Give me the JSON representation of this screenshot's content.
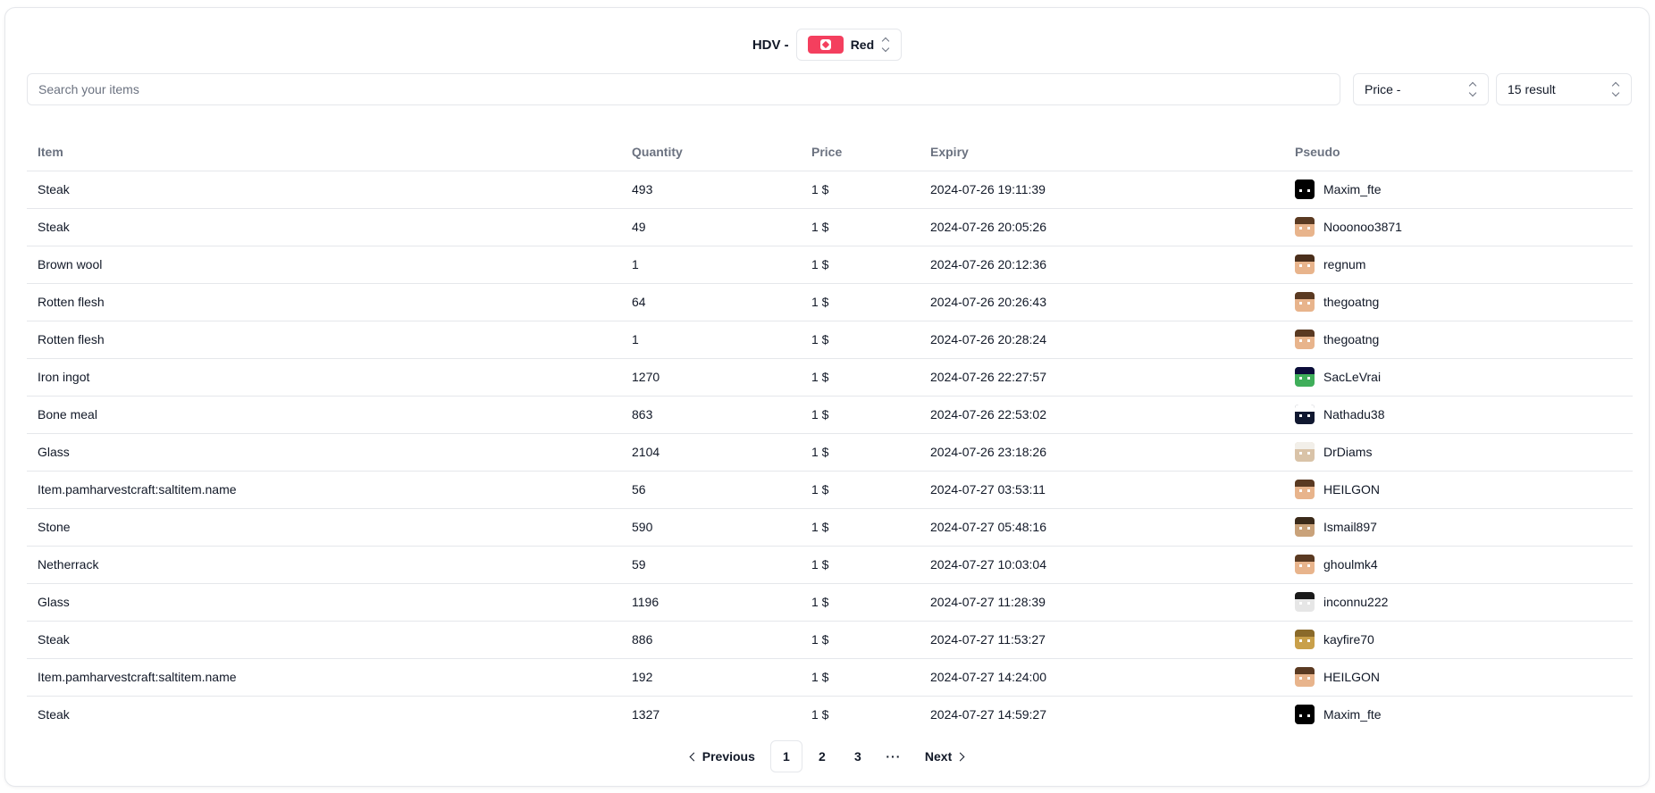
{
  "header": {
    "label": "HDV -",
    "server": {
      "name": "Red",
      "color": "#f43f5e",
      "icon": "cube-icon"
    }
  },
  "search": {
    "placeholder": "Search your items",
    "value": ""
  },
  "filters": {
    "sort": "Price -",
    "results": "15 result"
  },
  "table": {
    "columns": [
      "Item",
      "Quantity",
      "Price",
      "Expiry",
      "Pseudo"
    ],
    "rows": [
      {
        "item": "Steak",
        "quantity": "493",
        "price": "1 $",
        "expiry": "2024-07-26 19:11:39",
        "pseudo": "Maxim_fte",
        "avatar": {
          "skin": "#000000",
          "hair": "#000000"
        }
      },
      {
        "item": "Steak",
        "quantity": "49",
        "price": "1 $",
        "expiry": "2024-07-26 20:05:26",
        "pseudo": "Nooonoo3871",
        "avatar": {
          "skin": "#e8b48c",
          "hair": "#5a3a22"
        }
      },
      {
        "item": "Brown wool",
        "quantity": "1",
        "price": "1 $",
        "expiry": "2024-07-26 20:12:36",
        "pseudo": "regnum",
        "avatar": {
          "skin": "#e8b48c",
          "hair": "#4a2f1c"
        }
      },
      {
        "item": "Rotten flesh",
        "quantity": "64",
        "price": "1 $",
        "expiry": "2024-07-26 20:26:43",
        "pseudo": "thegoatng",
        "avatar": {
          "skin": "#e8b48c",
          "hair": "#5a3a22"
        }
      },
      {
        "item": "Rotten flesh",
        "quantity": "1",
        "price": "1 $",
        "expiry": "2024-07-26 20:28:24",
        "pseudo": "thegoatng",
        "avatar": {
          "skin": "#e8b48c",
          "hair": "#5a3a22"
        }
      },
      {
        "item": "Iron ingot",
        "quantity": "1270",
        "price": "1 $",
        "expiry": "2024-07-26 22:27:57",
        "pseudo": "SacLeVrai",
        "avatar": {
          "skin": "#3fae5a",
          "hair": "#0c0c3a"
        }
      },
      {
        "item": "Bone meal",
        "quantity": "863",
        "price": "1 $",
        "expiry": "2024-07-26 22:53:02",
        "pseudo": "Nathadu38",
        "avatar": {
          "skin": "#101830",
          "hair": "#ffffff"
        }
      },
      {
        "item": "Glass",
        "quantity": "2104",
        "price": "1 $",
        "expiry": "2024-07-26 23:18:26",
        "pseudo": "DrDiams",
        "avatar": {
          "skin": "#d9c3a8",
          "hair": "#f2efe9"
        }
      },
      {
        "item": "Item.pamharvestcraft:saltitem.name",
        "quantity": "56",
        "price": "1 $",
        "expiry": "2024-07-27 03:53:11",
        "pseudo": "HEILGON",
        "avatar": {
          "skin": "#e8b48c",
          "hair": "#5a3a22"
        }
      },
      {
        "item": "Stone",
        "quantity": "590",
        "price": "1 $",
        "expiry": "2024-07-27 05:48:16",
        "pseudo": "Ismail897",
        "avatar": {
          "skin": "#c9a27a",
          "hair": "#3a2a1a"
        }
      },
      {
        "item": "Netherrack",
        "quantity": "59",
        "price": "1 $",
        "expiry": "2024-07-27 10:03:04",
        "pseudo": "ghoulmk4",
        "avatar": {
          "skin": "#e8b48c",
          "hair": "#5a3a22"
        }
      },
      {
        "item": "Glass",
        "quantity": "1196",
        "price": "1 $",
        "expiry": "2024-07-27 11:28:39",
        "pseudo": "inconnu222",
        "avatar": {
          "skin": "#e6e6e6",
          "hair": "#1a1a1a"
        }
      },
      {
        "item": "Steak",
        "quantity": "886",
        "price": "1 $",
        "expiry": "2024-07-27 11:53:27",
        "pseudo": "kayfire70",
        "avatar": {
          "skin": "#c9a04a",
          "hair": "#8a6a2a"
        }
      },
      {
        "item": "Item.pamharvestcraft:saltitem.name",
        "quantity": "192",
        "price": "1 $",
        "expiry": "2024-07-27 14:24:00",
        "pseudo": "HEILGON",
        "avatar": {
          "skin": "#e8b48c",
          "hair": "#5a3a22"
        }
      },
      {
        "item": "Steak",
        "quantity": "1327",
        "price": "1 $",
        "expiry": "2024-07-27 14:59:27",
        "pseudo": "Maxim_fte",
        "avatar": {
          "skin": "#000000",
          "hair": "#000000"
        }
      }
    ]
  },
  "pagination": {
    "previous": "Previous",
    "next": "Next",
    "pages": [
      "1",
      "2",
      "3"
    ],
    "current": "1",
    "ellipsis": "···"
  }
}
